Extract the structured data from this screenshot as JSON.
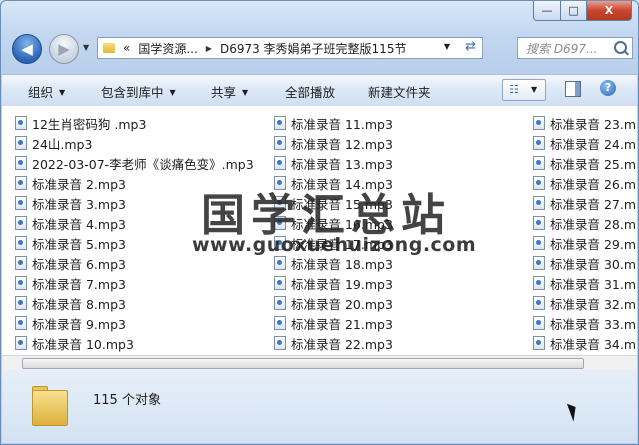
{
  "breadcrumb": {
    "overflow": "«",
    "parent": "国学资源...",
    "current": "D6973 李秀娟弟子班完整版115节"
  },
  "search": {
    "placeholder": "搜索 D697..."
  },
  "window_buttons": {
    "minimize": "—",
    "maximize": "□",
    "close": "X"
  },
  "toolbar": {
    "organize": "组织",
    "include_in_library": "包含到库中",
    "share": "共享",
    "play_all": "全部播放",
    "new_folder": "新建文件夹"
  },
  "files": {
    "col1": [
      "12生肖密码狗 .mp3",
      "24山.mp3",
      "2022-03-07-李老师《谈痛色变》.mp3",
      "标准录音 2.mp3",
      "标准录音 3.mp3",
      "标准录音 4.mp3",
      "标准录音 5.mp3",
      "标准录音 6.mp3",
      "标准录音 7.mp3",
      "标准录音 8.mp3",
      "标准录音 9.mp3",
      "标准录音 10.mp3"
    ],
    "col2": [
      "标准录音 11.mp3",
      "标准录音 12.mp3",
      "标准录音 13.mp3",
      "标准录音 14.mp3",
      "标准录音 15.mp3",
      "标准录音 16.mp3",
      "标准录音 17.mp3",
      "标准录音 18.mp3",
      "标准录音 19.mp3",
      "标准录音 20.mp3",
      "标准录音 21.mp3",
      "标准录音 22.mp3"
    ],
    "col3": [
      "标准录音 23.m",
      "标准录音 24.m",
      "标准录音 25.m",
      "标准录音 26.m",
      "标准录音 27.m",
      "标准录音 28.m",
      "标准录音 29.m",
      "标准录音 30.m",
      "标准录音 31.m",
      "标准录音 32.m",
      "标准录音 33.m",
      "标准录音 34.m"
    ]
  },
  "watermark": {
    "title": "国学汇总站",
    "url": "www.guoxuehuizong.com"
  },
  "status": {
    "count": "115 个对象"
  }
}
